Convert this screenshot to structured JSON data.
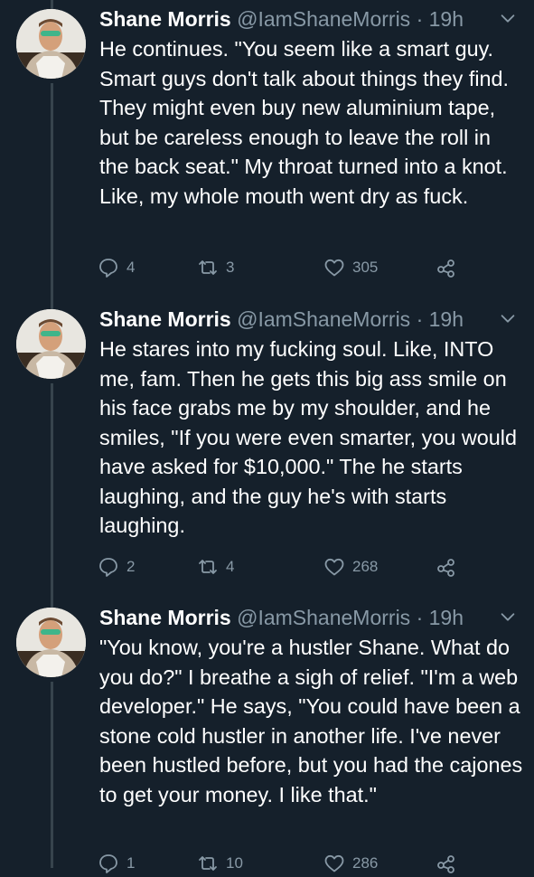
{
  "tweets": [
    {
      "author_name": "Shane Morris",
      "author_handle": "@IamShaneMorris",
      "separator": "·",
      "time": "19h",
      "text": "He continues. \"You seem like a smart guy. Smart guys don't talk about things they find. They might even buy new aluminium tape, but be careless enough to leave the roll in the back seat.\" My throat turned into a knot. Like, my whole mouth went dry as fuck.",
      "replies": "4",
      "retweets": "3",
      "likes": "305"
    },
    {
      "author_name": "Shane Morris",
      "author_handle": "@IamShaneMorris",
      "separator": "·",
      "time": "19h",
      "text": "He stares into my fucking soul. Like, INTO me, fam. Then he gets this big ass smile on his face grabs me by my shoulder, and he smiles, \"If you were even smarter, you would have asked for $10,000.\" The he starts laughing, and the guy he's with starts laughing.",
      "replies": "2",
      "retweets": "4",
      "likes": "268"
    },
    {
      "author_name": "Shane Morris",
      "author_handle": "@IamShaneMorris",
      "separator": "·",
      "time": "19h",
      "text": "\"You know, you're a hustler Shane. What do you do?\" I breathe a sigh of relief. \"I'm a web developer.\" He says, \"You could have been a stone cold hustler in another life. I've never been hustled before, but you had the cajones to get your money. I like that.\"",
      "replies": "1",
      "retweets": "10",
      "likes": "286"
    }
  ],
  "colors": {
    "background": "#15202b",
    "text": "#ffffff",
    "muted": "#8899a6",
    "thread_line": "#37444d"
  }
}
